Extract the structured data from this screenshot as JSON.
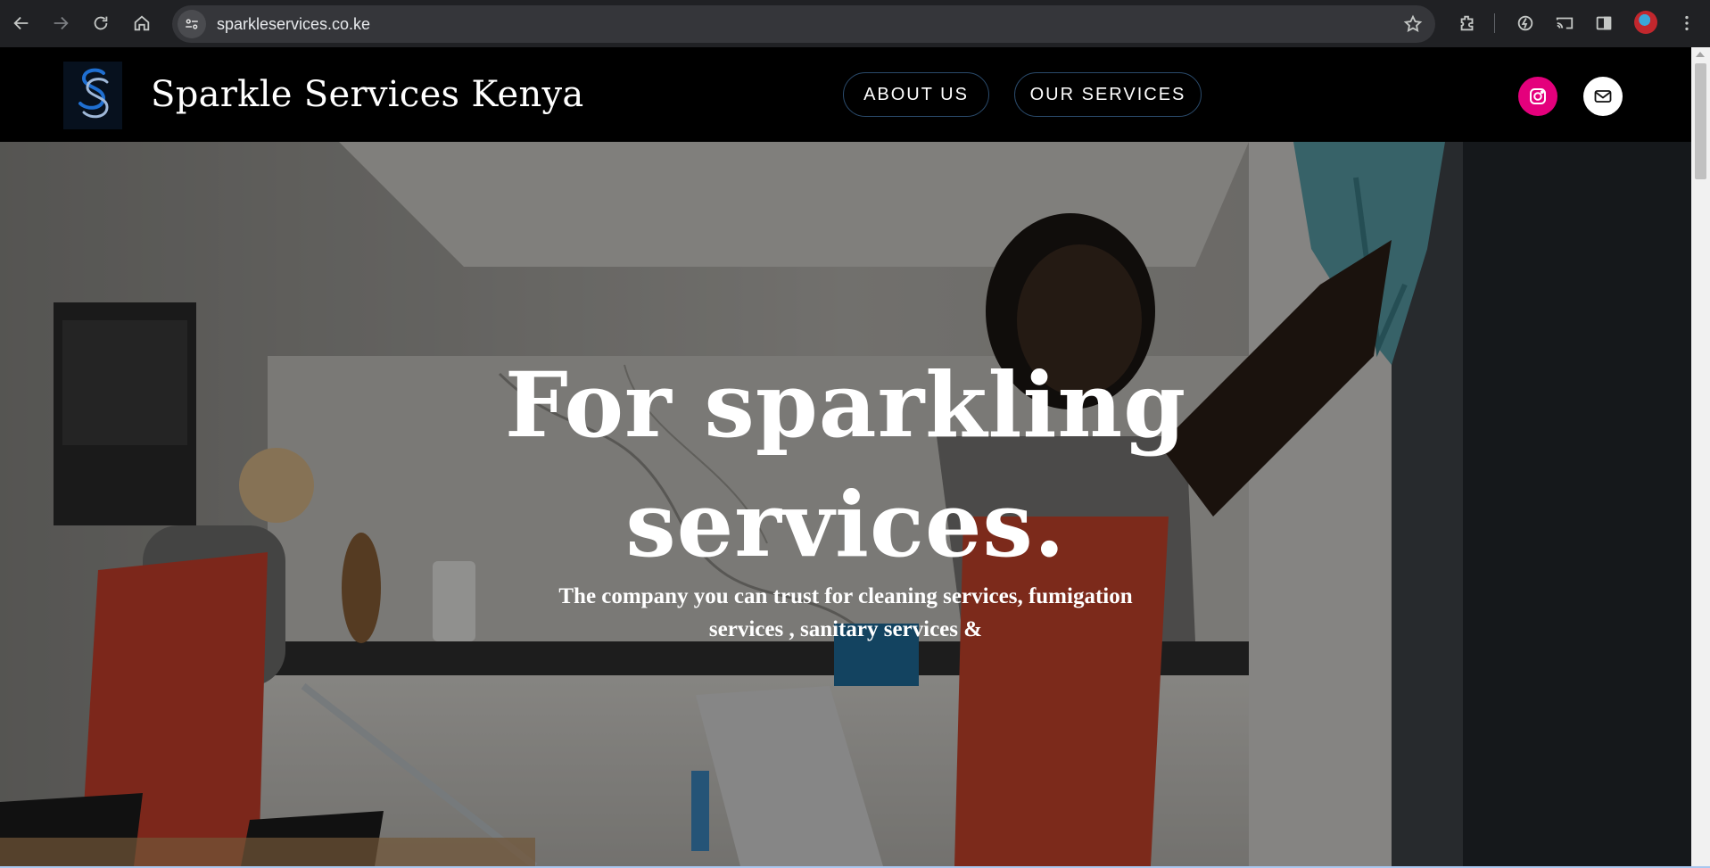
{
  "browser": {
    "url": "sparkleservices.co.ke",
    "icons": [
      "back-icon",
      "forward-icon",
      "reload-icon",
      "home-icon",
      "site-info-icon",
      "bookmark-star-icon",
      "extensions-icon",
      "performance-icon",
      "cast-icon",
      "side-panel-icon",
      "profile-avatar",
      "menu-icon"
    ]
  },
  "header": {
    "brand_name": "Sparkle Services Kenya",
    "logo_icon": "ss-monogram-logo",
    "nav": [
      {
        "label": "ABOUT US"
      },
      {
        "label": "OUR SERVICES"
      }
    ],
    "social": [
      {
        "icon": "instagram-icon",
        "color": "#e4007c"
      },
      {
        "icon": "mail-icon",
        "color": "#ffffff"
      }
    ]
  },
  "hero": {
    "title_line1": "For sparkling",
    "title_line2": "services.",
    "subtitle_line1": "The company you can trust for cleaning services, fumigation",
    "subtitle_line2": "services , sanitary services &"
  },
  "colors": {
    "header_bg": "#000000",
    "nav_border": "#2a4a6b",
    "instagram": "#e4007c",
    "chrome_bg": "#202124"
  }
}
